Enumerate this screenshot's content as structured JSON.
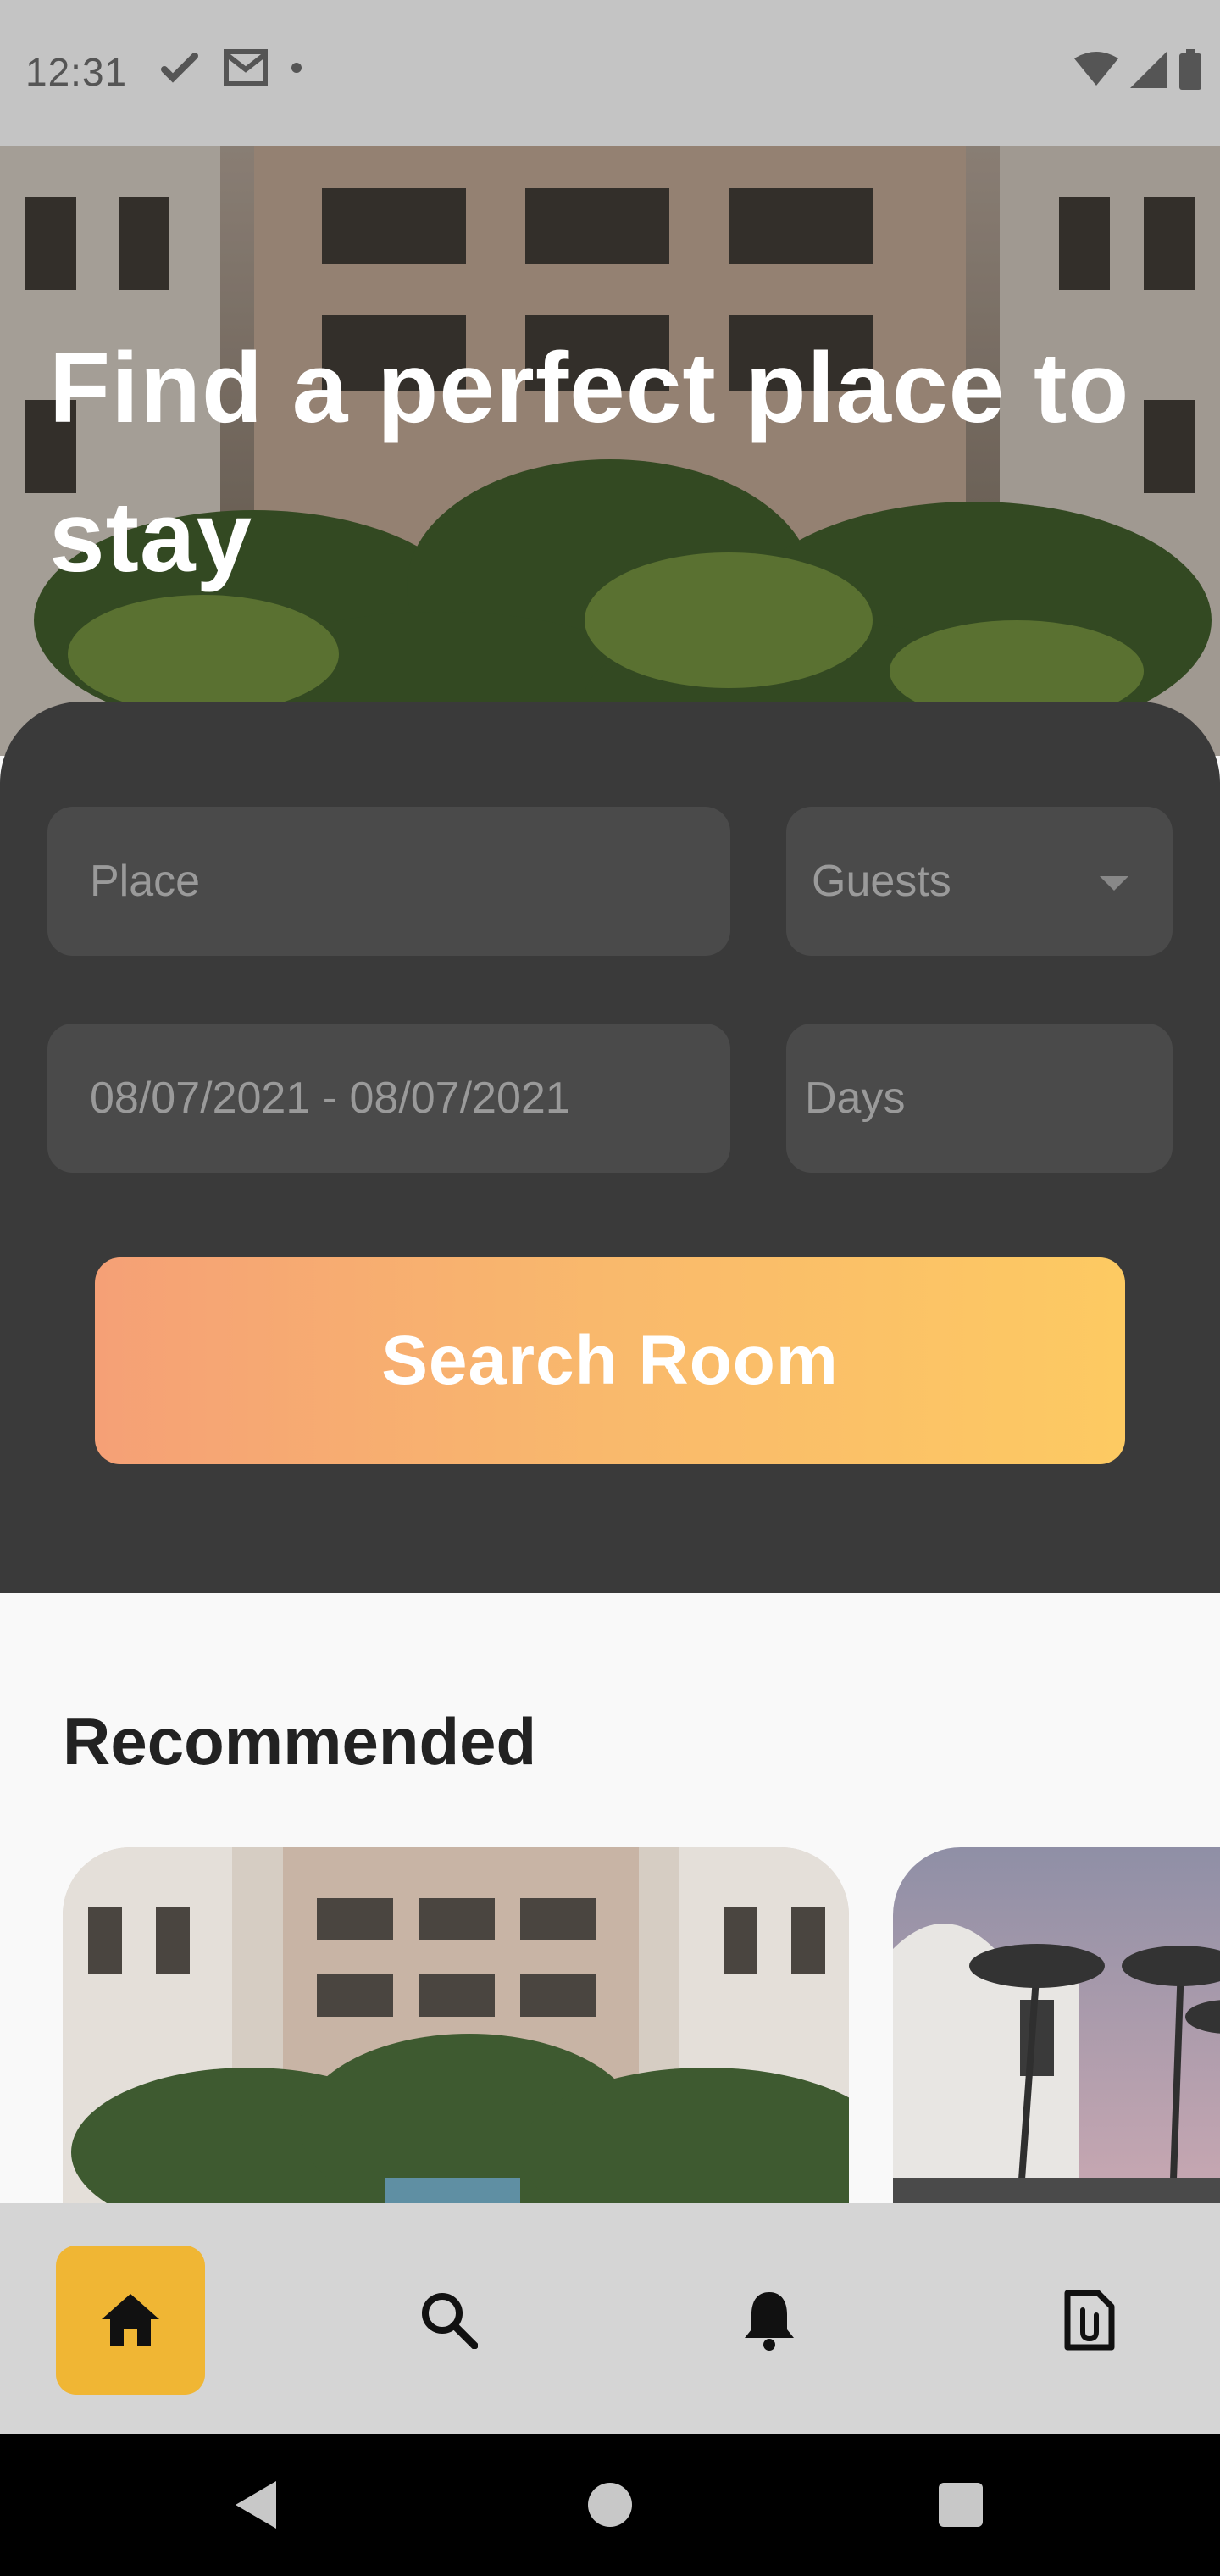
{
  "status_bar": {
    "time": "12:31"
  },
  "hero": {
    "title": "Find a perfect place to stay"
  },
  "search": {
    "place_placeholder": "Place",
    "guests_placeholder": "Guests",
    "date_range": "08/07/2021 - 08/07/2021",
    "days_placeholder": "Days",
    "button_label": "Search Room"
  },
  "recommended": {
    "title": "Recommended"
  },
  "bottom_nav": {
    "items": [
      {
        "icon": "home-icon",
        "active": true
      },
      {
        "icon": "search-icon",
        "active": false
      },
      {
        "icon": "bell-icon",
        "active": false
      },
      {
        "icon": "document-clip-icon",
        "active": false
      }
    ]
  },
  "colors": {
    "panel": "#3a3a3a",
    "field": "#4a4a4a",
    "accent": "#f0b634",
    "button_gradient_start": "#f5a076",
    "button_gradient_end": "#fdca62"
  }
}
